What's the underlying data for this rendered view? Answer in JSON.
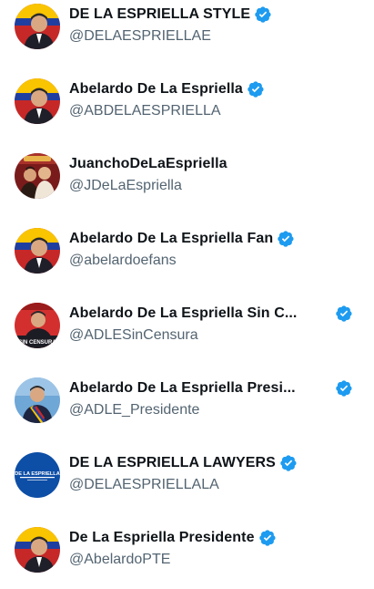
{
  "accounts": [
    {
      "name": "DE LA ESPRIELLA STYLE",
      "handle": "@DELAESPRIELLAE",
      "verified": true,
      "avatar_icon": "portrait-flag-avatar",
      "avatar_colors": [
        "#c62828",
        "#f9c400",
        "#1f1f2a"
      ]
    },
    {
      "name": "Abelardo De La Espriella",
      "handle": "@ABDELAESPRIELLA",
      "verified": true,
      "avatar_icon": "portrait-flag-avatar",
      "avatar_colors": [
        "#c62828",
        "#f9c400",
        "#1f1f2a"
      ]
    },
    {
      "name": "JuanchoDeLaEspriella",
      "handle": "@JDeLaEspriella",
      "verified": false,
      "avatar_icon": "group-photo-avatar",
      "avatar_colors": [
        "#7a1b1b",
        "#e8b34a",
        "#2a1a14"
      ]
    },
    {
      "name": "Abelardo De La Espriella Fan",
      "handle": "@abelardoefans",
      "verified": true,
      "avatar_icon": "portrait-flag-avatar",
      "avatar_colors": [
        "#c62828",
        "#f9c400",
        "#1f1f2a"
      ]
    },
    {
      "name": "Abelardo De La Espriella Sin C...",
      "handle": "@ADLESinCensura",
      "verified": true,
      "avatar_icon": "sin-censura-avatar",
      "avatar_colors": [
        "#d32f2f",
        "#ffffff",
        "#1c1c24"
      ],
      "avatar_caption": "SIN CENSURA"
    },
    {
      "name": "Abelardo De La Espriella Presi...",
      "handle": "@ADLE_Presidente",
      "verified": true,
      "avatar_icon": "presidential-portrait-avatar",
      "avatar_colors": [
        "#6fa7d6",
        "#f9c400",
        "#1d2540"
      ]
    },
    {
      "name": "DE LA ESPRIELLA LAWYERS",
      "handle": "@DELAESPRIELLALA",
      "verified": true,
      "avatar_icon": "law-firm-logo-avatar",
      "avatar_colors": [
        "#0d4ea6",
        "#ffffff"
      ],
      "avatar_caption": "DE LA ESPRIELLA"
    },
    {
      "name": "De La Espriella Presidente",
      "handle": "@AbelardoPTE",
      "verified": true,
      "avatar_icon": "portrait-flag-avatar",
      "avatar_colors": [
        "#c62828",
        "#f9c400",
        "#1f1f2a"
      ]
    }
  ],
  "colors": {
    "name_text": "#0f1419",
    "handle_text": "#536471",
    "verified_badge": "#1d9bf0"
  }
}
